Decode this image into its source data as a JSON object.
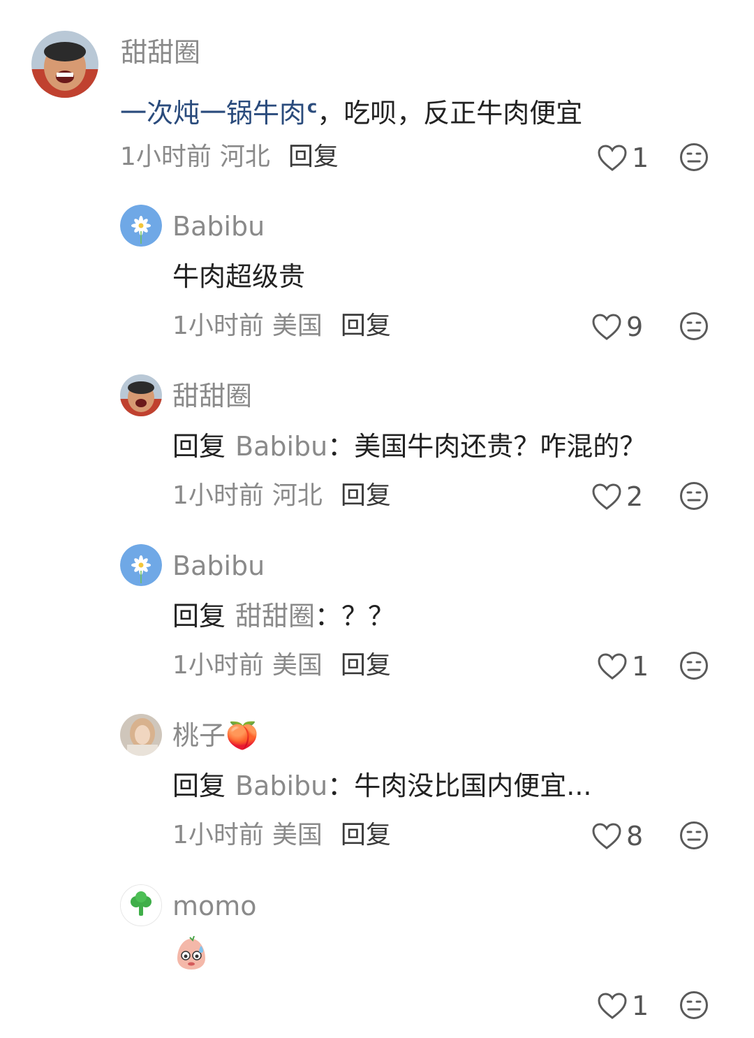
{
  "comments": [
    {
      "user": "甜甜圈",
      "text_link": "一次炖一锅牛肉",
      "text_rest": "，吃呗，反正牛肉便宜",
      "time": "1小时前",
      "location": "河北",
      "reply_label": "回复",
      "likes": "1"
    },
    {
      "user": "Babibu",
      "text": "牛肉超级贵",
      "time": "1小时前",
      "location": "美国",
      "reply_label": "回复",
      "likes": "9"
    },
    {
      "user": "甜甜圈",
      "reply_prefix": "回复",
      "reply_target": "Babibu",
      "text": "：美国牛肉还贵？咋混的？",
      "time": "1小时前",
      "location": "河北",
      "reply_label": "回复",
      "likes": "2"
    },
    {
      "user": "Babibu",
      "reply_prefix": "回复",
      "reply_target": "甜甜圈",
      "text": "：？？",
      "time": "1小时前",
      "location": "美国",
      "reply_label": "回复",
      "likes": "1"
    },
    {
      "user": "桃子🍑",
      "reply_prefix": "回复",
      "reply_target": "Babibu",
      "text": "：牛肉没比国内便宜...",
      "time": "1小时前",
      "location": "美国",
      "reply_label": "回复",
      "likes": "8"
    },
    {
      "user": "momo",
      "text": "",
      "likes": "1"
    }
  ],
  "icons": {
    "like": "heart-outline-icon",
    "react": "neutral-face-icon",
    "search": "magnifier-icon"
  },
  "colors": {
    "link": "#2a4b7c",
    "muted": "#8a8a8a",
    "avatar_babibu": "#6fa8e6",
    "avatar_momo_bg": "#ffffff"
  }
}
